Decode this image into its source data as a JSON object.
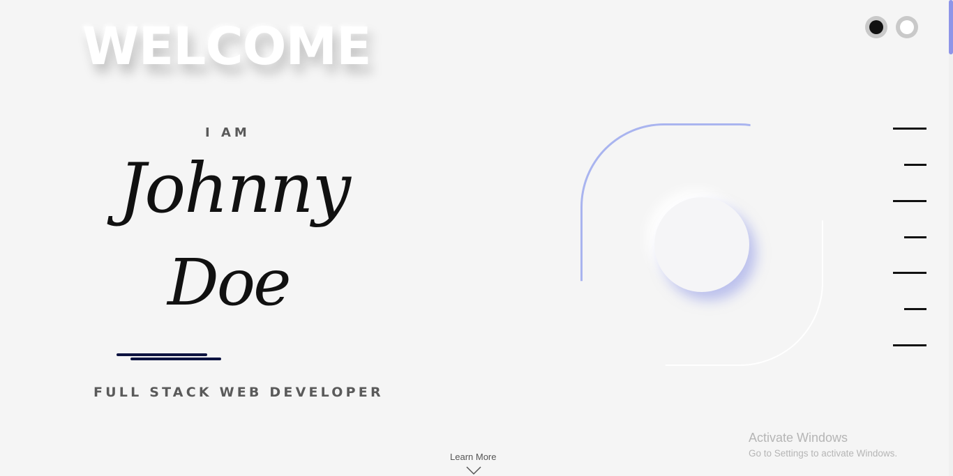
{
  "hero": {
    "welcome": "WELCOME",
    "intro": "I AM",
    "first_name": "Johnny",
    "last_name": "Doe",
    "role": "FULL STACK WEB DEVELOPER"
  },
  "theme_toggle": {
    "options": [
      "dark",
      "light"
    ],
    "selected": "dark"
  },
  "side_nav": {
    "item_count": 7
  },
  "footer": {
    "learn_more": "Learn More"
  },
  "watermark": {
    "title": "Activate Windows",
    "subtitle": "Go to Settings to activate Windows."
  },
  "colors": {
    "background": "#f5f5f5",
    "accent": "#8e95e8",
    "underline": "#0d1340"
  }
}
